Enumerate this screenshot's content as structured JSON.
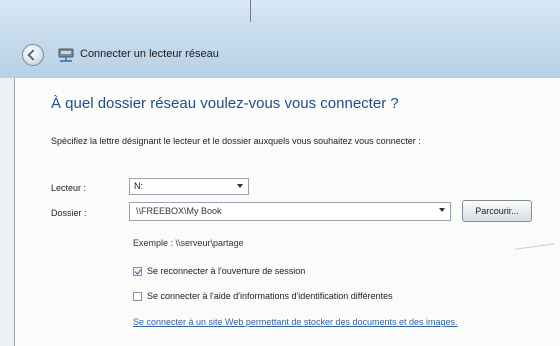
{
  "window": {
    "title": "Connecter un lecteur réseau"
  },
  "dialog": {
    "heading": "À quel dossier réseau voulez-vous vous connecter ?",
    "instructions": "Spécifiez la lettre désignant le lecteur et le dossier auxquels vous souhaitez vous connecter :"
  },
  "form": {
    "drive_label": "Lecteur :",
    "drive_value": "N:",
    "folder_label": "Dossier :",
    "folder_value": "\\\\FREEBOX\\My Book",
    "browse_label": "Parcourir...",
    "example": "Exemple : \\\\serveur\\partage"
  },
  "options": {
    "reconnect_label": "Se reconnecter à l'ouverture de session",
    "reconnect_checked": true,
    "other_credentials_label": "Se connecter à l'aide d'informations d'identification différentes",
    "other_credentials_checked": false,
    "link": "Se connecter à un site Web permettant de stocker des documents et des images."
  },
  "icons": {
    "back": "back-arrow-icon",
    "network_drive": "network-drive-icon"
  }
}
